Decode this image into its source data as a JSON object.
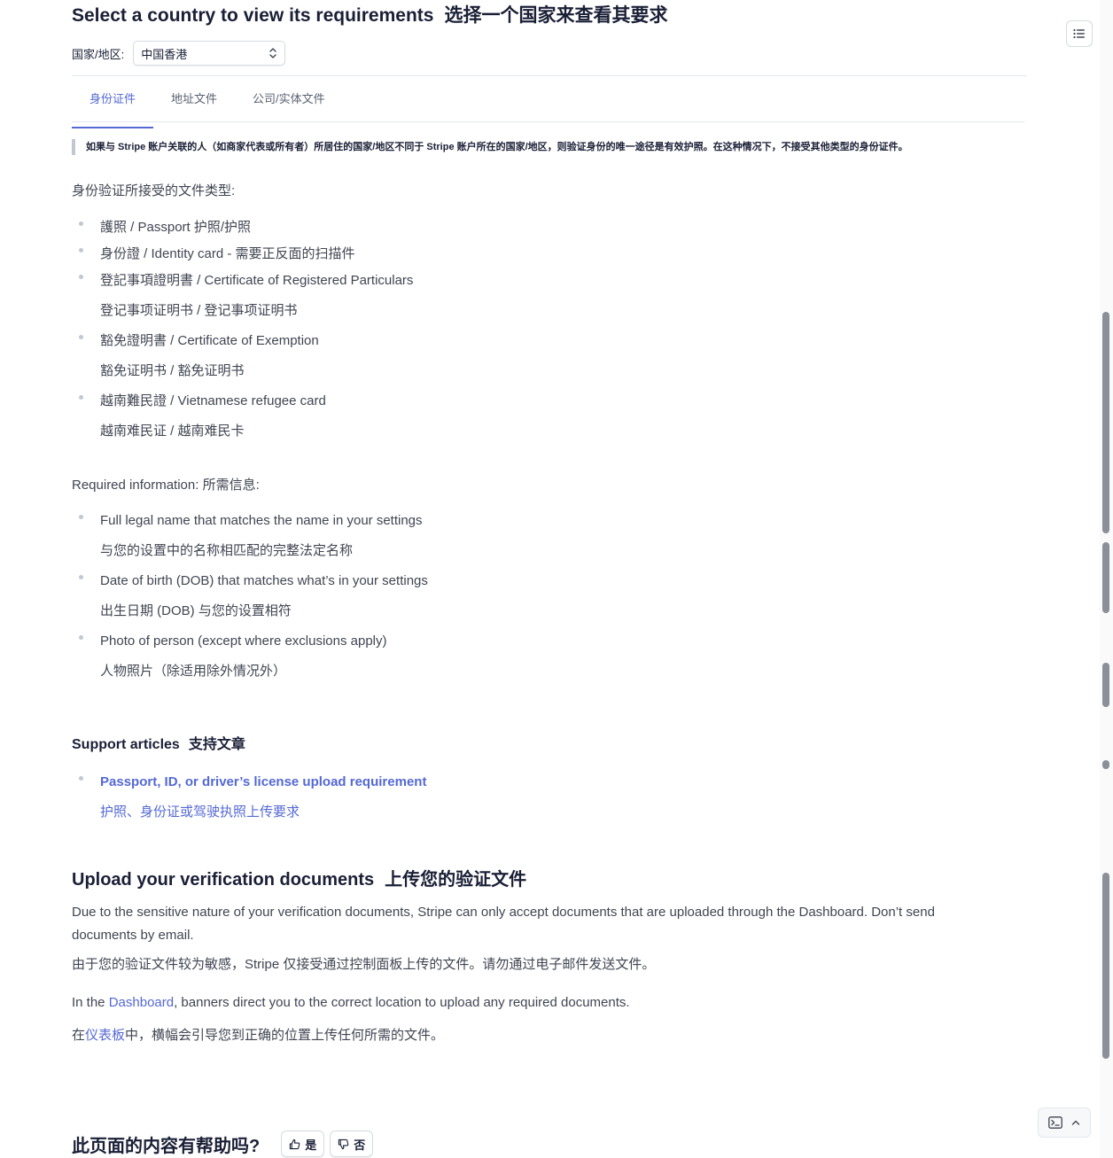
{
  "header": {
    "title_en": "Select a country to view its requirements",
    "title_zh": "选择一个国家来查看其要求"
  },
  "country": {
    "label": "国家/地区:",
    "selected": "中国香港"
  },
  "tabs": [
    {
      "label": "身份证件",
      "active": true
    },
    {
      "label": "地址文件",
      "active": false
    },
    {
      "label": "公司/实体文件",
      "active": false
    }
  ],
  "callout": "如果与 Stripe 账户关联的人（如商家代表或所有者）所居住的国家/地区不同于 Stripe 账户所在的国家/地区，则验证身份的唯一途径是有效护照。在这种情况下，不接受其他类型的身份证件。",
  "accepted_docs": {
    "heading": "身份验证所接受的文件类型:",
    "items": [
      {
        "line": "護照 / Passport  护照/护照",
        "sub": ""
      },
      {
        "line": "身份證 / Identity card - 需要正反面的扫描件",
        "sub": ""
      },
      {
        "line": "登記事項證明書 / Certificate of Registered Particulars",
        "sub": "登记事项证明书 / 登记事项证明书"
      },
      {
        "line": "豁免證明書 / Certificate of Exemption",
        "sub": "豁免证明书 / 豁免证明书"
      },
      {
        "line": "越南難民證 / Vietnamese refugee card",
        "sub": "越南难民证 / 越南难民卡"
      }
    ]
  },
  "required_info": {
    "heading": "Required information:  所需信息:",
    "items": [
      {
        "line": "Full legal name that matches the name in your settings",
        "sub": "与您的设置中的名称相匹配的完整法定名称"
      },
      {
        "line": "Date of birth (DOB) that matches what’s in your settings",
        "sub": "出生日期 (DOB) 与您的设置相符"
      },
      {
        "line": "Photo of person (except where exclusions apply)",
        "sub": "人物照片（除适用除外情况外）"
      }
    ]
  },
  "support": {
    "heading_en": "Support articles",
    "heading_zh": "支持文章",
    "link_en": "Passport, ID, or driver’s license upload requirement",
    "link_zh": "护照、身份证或驾驶执照上传要求"
  },
  "upload": {
    "title_en": "Upload your verification documents",
    "title_zh": "上传您的验证文件",
    "p1_line1": "Due to the sensitive nature of your verification documents, Stripe can only accept documents that are uploaded through the Dashboard. Don’t send",
    "p1_line2": "documents by email.",
    "p1_zh": "由于您的验证文件较为敏感，Stripe 仅接受通过控制面板上传的文件。请勿通过电子邮件发送文件。",
    "p2_before": "In the ",
    "p2_link": "Dashboard",
    "p2_after": ", banners direct you to the correct location to upload any required documents.",
    "p2_zh_before": "在",
    "p2_zh_link": "仪表板",
    "p2_zh_after": "中，横幅会引导您到正确的位置上传任何所需的文件。"
  },
  "feedback": {
    "question": "此页面的内容有帮助吗?",
    "yes": "是",
    "no": "否"
  },
  "colors": {
    "accent": "#5469d4",
    "heading": "#1a1f36",
    "body": "#414552",
    "bullet": "#c0c8d2"
  }
}
